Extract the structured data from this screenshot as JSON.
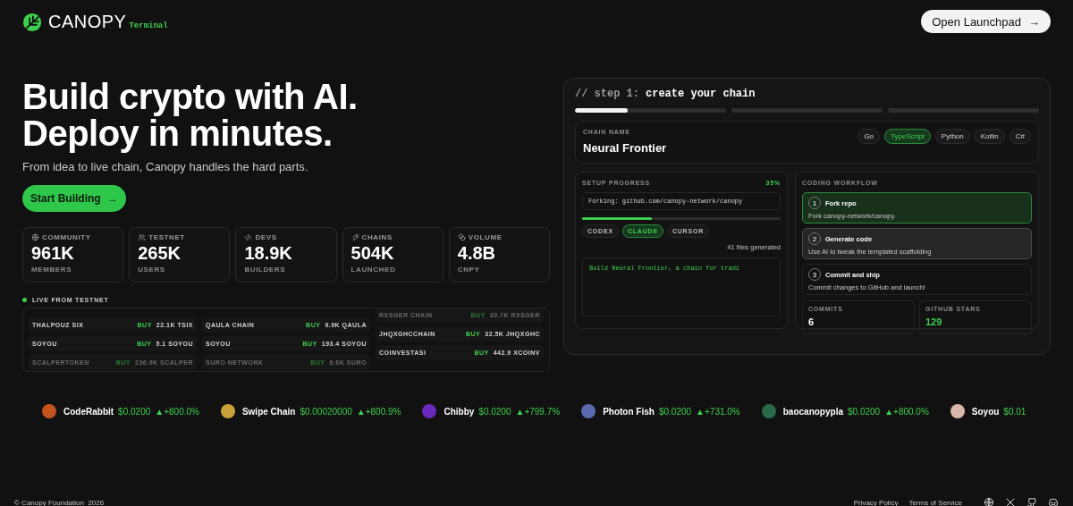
{
  "header": {
    "brand": "CANOPY",
    "badge": "Terminal",
    "cta": "Open Launchpad",
    "cta_arrow": "→"
  },
  "hero": {
    "title_lines": [
      "Build crypto with AI.",
      "Deploy in minutes."
    ],
    "subtitle": "From idea to live chain, Canopy handles the hard parts.",
    "button": "Start Building",
    "button_arrow": "→"
  },
  "stats": [
    {
      "kind": "globe",
      "label": "COMMUNITY",
      "value": "961K",
      "unit": "MEMBERS"
    },
    {
      "kind": "users",
      "label": "TESTNET",
      "value": "265K",
      "unit": "USERS"
    },
    {
      "kind": "code",
      "label": "DEVS",
      "value": "18.9K",
      "unit": "BUILDERS"
    },
    {
      "kind": "rocket",
      "label": "CHAINS",
      "value": "504K",
      "unit": "LAUNCHED"
    },
    {
      "kind": "coins",
      "label": "VOLUME",
      "value": "4.8B",
      "unit": "CNPY"
    }
  ],
  "live_feed": {
    "title": "LIVE FROM TESTNET",
    "columns": [
      [
        {
          "name": "THALPOUZ SIX",
          "action": "BUY",
          "amount": "22.1K TSIX",
          "faded": false
        },
        {
          "name": "SOYOU",
          "action": "BUY",
          "amount": "5.1 SOYOU",
          "faded": false
        },
        {
          "name": "SCALPERTOKEN",
          "action": "BUY",
          "amount": "236.9K SCALPER",
          "faded": true
        }
      ],
      [
        {
          "name": "QAULA CHAIN",
          "action": "BUY",
          "amount": "9.9K QAULA",
          "faded": false
        },
        {
          "name": "SOYOU",
          "action": "BUY",
          "amount": "193.4 SOYOU",
          "faded": false
        },
        {
          "name": "SURO NETWORK",
          "action": "BUY",
          "amount": "6.6K SURO",
          "faded": true
        }
      ],
      [
        {
          "name": "RXSGER CHAIN",
          "action": "BUY",
          "amount": "30.7K RXSGER",
          "faded": true
        },
        {
          "name": "JHQXGHCCHAIN",
          "action": "BUY",
          "amount": "32.5K JHQXGHC",
          "faded": false
        },
        {
          "name": "COINVESTASI",
          "action": "BUY",
          "amount": "442.9 XCOINV",
          "faded": false
        }
      ]
    ]
  },
  "terminal": {
    "comment": "// step 1:",
    "title": "create your chain",
    "steps": [
      {
        "level": 0.35
      },
      {
        "level": 0
      },
      {
        "level": 0
      }
    ],
    "chain_name": {
      "label": "CHAIN NAME",
      "value": "Neural Frontier"
    },
    "languages": [
      {
        "label": "Go",
        "selected": false
      },
      {
        "label": "TypeScript",
        "selected": true
      },
      {
        "label": "Python",
        "selected": false
      },
      {
        "label": "Kotlin",
        "selected": false
      },
      {
        "label": "C#",
        "selected": false
      }
    ],
    "setup": {
      "label": "SETUP PROGRESS",
      "percent": "35%",
      "status": "Forking: github.com/canopy-network/canopy",
      "level": 0.35,
      "agents": [
        {
          "label": "CODEX",
          "selected": false
        },
        {
          "label": "CLAUDE",
          "selected": true
        },
        {
          "label": "CURSOR",
          "selected": false
        }
      ],
      "files": "41 files generated",
      "prompt": "Build Neural Frontier, a chain for tradi"
    },
    "workflow": {
      "label": "CODING WORKFLOW",
      "steps": [
        {
          "number": "1",
          "title": "Fork repo",
          "description": "Fork canopy-network/canopy.",
          "completed": true,
          "selected": false
        },
        {
          "number": "2",
          "title": "Generate code",
          "description": "Use AI to tweak the templated scaffolding",
          "completed": false,
          "selected": true
        },
        {
          "number": "3",
          "title": "Commit and ship",
          "description": "Commit changes to GitHub and launch!",
          "completed": false,
          "selected": false
        }
      ],
      "metrics": [
        {
          "label": "COMMITS",
          "value": "6",
          "color": "#ffffff"
        },
        {
          "label": "GITHUB STARS",
          "value": "129",
          "color": "#3ecf4e"
        }
      ]
    }
  },
  "ticker": [
    {
      "name": "CodeRabbit",
      "price": "$0.0200",
      "change": "▲+800.0%",
      "color": "#c4531e"
    },
    {
      "name": "Swipe Chain",
      "price": "$0.00020000",
      "change": "▲+800.9%",
      "color": "#c9a23a"
    },
    {
      "name": "Chibby",
      "price": "$0.0200",
      "change": "▲+799.7%",
      "color": "#6a2bbd"
    },
    {
      "name": "Photon Fish",
      "price": "$0.0200",
      "change": "▲+731.0%",
      "color": "#5a6ab0"
    },
    {
      "name": "baocanopypla",
      "price": "$0.0200",
      "change": "▲+800.0%",
      "color": "#2a6a4a"
    },
    {
      "name": "Soyou",
      "price": "$0.01",
      "color": "#d8b8a8"
    }
  ],
  "footer": {
    "copyright": "© Canopy Foundation  2026",
    "links": [
      "Privacy Policy",
      "Terms of Service"
    ],
    "socials": [
      {
        "kind": "globe"
      },
      {
        "kind": "x"
      },
      {
        "kind": "github"
      },
      {
        "kind": "discord"
      }
    ]
  }
}
